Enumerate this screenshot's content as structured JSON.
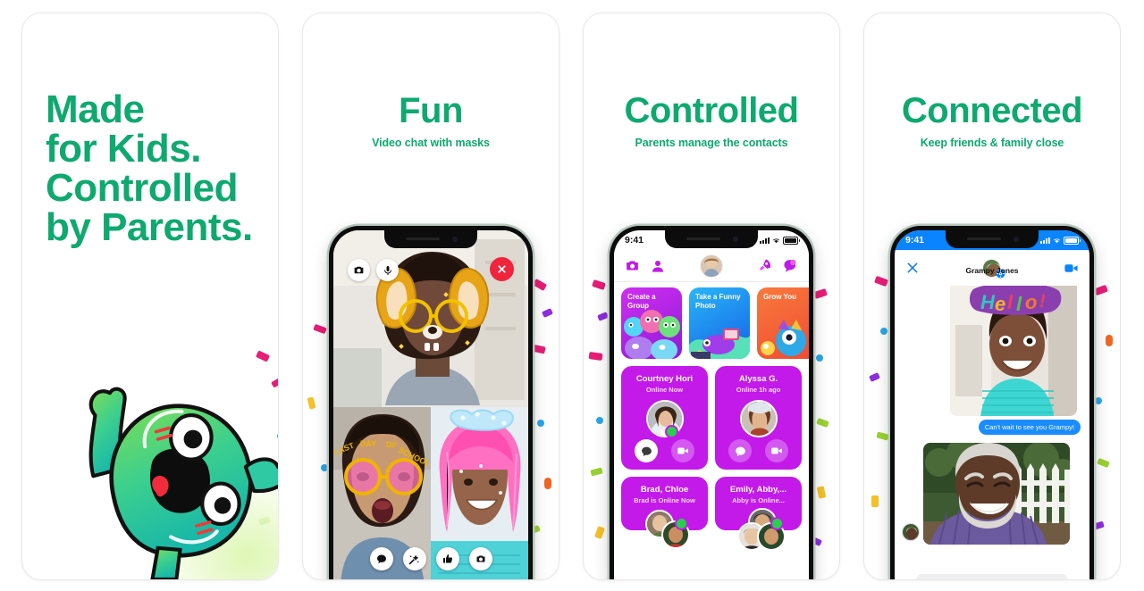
{
  "theme": {
    "brand_green": "#0ea96f",
    "purple": "#c31aea",
    "blue": "#0a84ff",
    "red": "#f0243c"
  },
  "panels": [
    {
      "id": "made-for-kids",
      "headline_lines": [
        "Made",
        "for Kids.",
        "Controlled",
        "by Parents."
      ],
      "subtitle": "",
      "mascot": "green-blob-mascot"
    },
    {
      "id": "fun",
      "headline": "Fun",
      "subtitle": "Video chat with masks",
      "phone": {
        "top_buttons": [
          {
            "name": "camera-button",
            "icon": "camera-icon"
          },
          {
            "name": "microphone-button",
            "icon": "microphone-icon"
          }
        ],
        "close_button": {
          "name": "close-call-button",
          "icon": "close-icon"
        },
        "toolbar": [
          {
            "name": "chat-button",
            "icon": "chat-bubble-icon"
          },
          {
            "name": "effects-button",
            "icon": "magic-wand-icon"
          },
          {
            "name": "like-button",
            "icon": "thumbs-up-icon"
          },
          {
            "name": "snapshot-button",
            "icon": "camera-icon"
          }
        ],
        "video_tiles": [
          {
            "name": "video-tile-main",
            "mask": "fox-ears-and-glasses"
          },
          {
            "name": "video-tile-left",
            "mask": "last-day-of-school-glasses"
          },
          {
            "name": "video-tile-right",
            "mask": "pink-hair-wig"
          }
        ]
      }
    },
    {
      "id": "controlled",
      "headline": "Controlled",
      "subtitle": "Parents manage the contacts",
      "phone": {
        "status_time": "9:41",
        "header_icons": [
          {
            "name": "camera-icon",
            "icon": "camera-icon"
          },
          {
            "name": "profile-icon",
            "icon": "person-icon"
          },
          {
            "name": "user-avatar",
            "icon": "avatar"
          },
          {
            "name": "rocket-icon",
            "icon": "rocket-icon"
          },
          {
            "name": "stickers-icon",
            "icon": "chat-bubbles-icon"
          }
        ],
        "feature_cards": [
          {
            "title": "Create a Group",
            "color": "#c11ae6"
          },
          {
            "title": "Take a Funny Photo",
            "color": "#1a8ef5"
          },
          {
            "title": "Grow You",
            "color": "#f4653a"
          }
        ],
        "contacts": [
          {
            "name": "Courtney Hori",
            "status": "Online Now",
            "online": true,
            "group": false
          },
          {
            "name": "Alyssa G.",
            "status": "Online 1h ago",
            "online": false,
            "group": false
          },
          {
            "name": "Brad, Chloe",
            "status": "Brad is Online Now",
            "online": true,
            "group": true
          },
          {
            "name": "Emily, Abby,...",
            "status": "Abby is Online...",
            "online": true,
            "group": true
          }
        ],
        "contact_actions": [
          {
            "name": "message-button",
            "icon": "chat-bubble-icon"
          },
          {
            "name": "video-call-button",
            "icon": "video-camera-icon"
          }
        ]
      }
    },
    {
      "id": "connected",
      "headline": "Connected",
      "subtitle": "Keep friends & family close",
      "phone": {
        "status_time": "9:41",
        "close_label": "close-icon",
        "contact_name": "Grampy Jones",
        "video_call_icon": "video-camera-icon",
        "settings_icon": "gear-icon",
        "messages": [
          {
            "type": "photo",
            "name": "hello-sticker-photo"
          },
          {
            "type": "text",
            "text": "Can't wait to see you Grampy!"
          },
          {
            "type": "photo",
            "name": "grandfather-photo"
          }
        ]
      }
    }
  ]
}
